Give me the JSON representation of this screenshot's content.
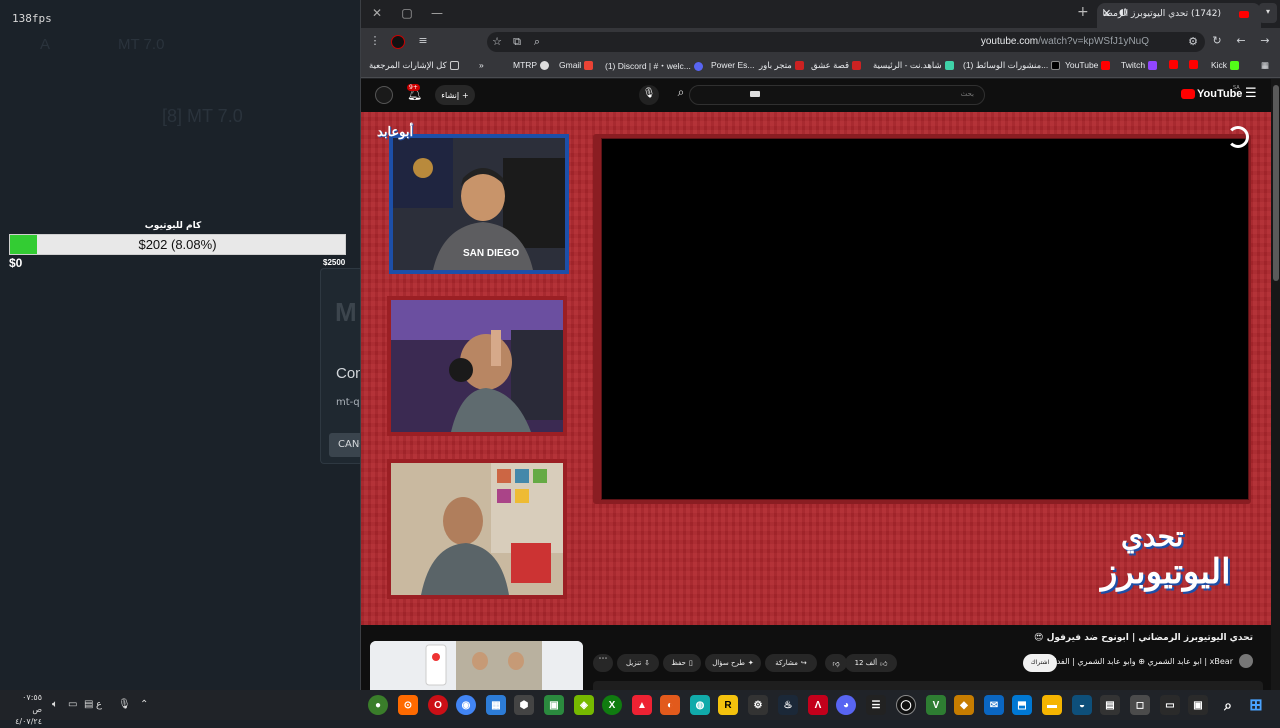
{
  "left_app": {
    "fps": "138fps",
    "ghost_a": "A",
    "ghost_title_small": "MT 7.0",
    "ghost_title_large": "[8] MT 7.0",
    "progress": {
      "label": "كام لليوتيوب",
      "value_text": "$202 (8.08%)",
      "fraction": 0.0808,
      "min_label": "$0",
      "max_label": "$2500"
    },
    "dialog": {
      "title": "Con",
      "subtitle": "mt-q",
      "cancel_label": "CANC"
    }
  },
  "browser": {
    "tab": {
      "title": "(1742) تحدي اليوتيوبرز الرمضا"
    },
    "url": {
      "host": "youtube.com",
      "path": "/watch?v=kpWSfJ1yNuQ"
    },
    "bookmarks": [
      {
        "label": "Kick",
        "color": "#53fc18"
      },
      {
        "label": "",
        "color": "#ff0000"
      },
      {
        "label": "",
        "color": "#ff0000"
      },
      {
        "label": "Twitch",
        "color": "#9146ff"
      },
      {
        "label": "YouTube",
        "color": "#ff0000"
      },
      {
        "label": "",
        "color": "#000000"
      },
      {
        "label": "(1) منشورات الوسائط...",
        "color": "#555555"
      },
      {
        "label": "شاهد.نت - الرئيسية",
        "color": "#3fd2a8"
      },
      {
        "label": "قصة عشق",
        "color": "#cc2222"
      },
      {
        "label": "متجر باور",
        "color": "#cc2222"
      },
      {
        "label": "Power Es...",
        "color": "#ff6a00"
      },
      {
        "label": "(1) Discord | #・welc...",
        "color": "#5865f2"
      },
      {
        "label": "Gmail",
        "color": "#ea4335"
      },
      {
        "label": "MTRP",
        "color": "#dddddd"
      }
    ],
    "bookmarks_all": "كل الإشارات المرجعية"
  },
  "youtube": {
    "search_placeholder": "بحث",
    "create_label": "إنشاء",
    "notification_count": "9+",
    "logo": "YouTube",
    "country": "SA",
    "overlay": {
      "cam_name": "أبوعابد",
      "brand_line1": "تحدي",
      "brand_line2": "اليوتيوبرز"
    },
    "video_title": "تحدي اليوتيوبرز الرمضاني | ابونوح ضد فيرفول 😍",
    "channel_name": "xBear | ابو عابد الشمري ⊕ وابو عابد الشمري | الفداء الثانية",
    "subscribe_label": "اشتراك",
    "likes_label": "12 ألف",
    "share_label": "مشاركة",
    "ask_label": "طرح سؤال",
    "save_label": "حفظ",
    "download_label": "تنزيل"
  },
  "taskbar": {
    "time": "٠٧:٥٥ ص",
    "date": "٤/٠٧/٢٤",
    "lang": "ع"
  }
}
